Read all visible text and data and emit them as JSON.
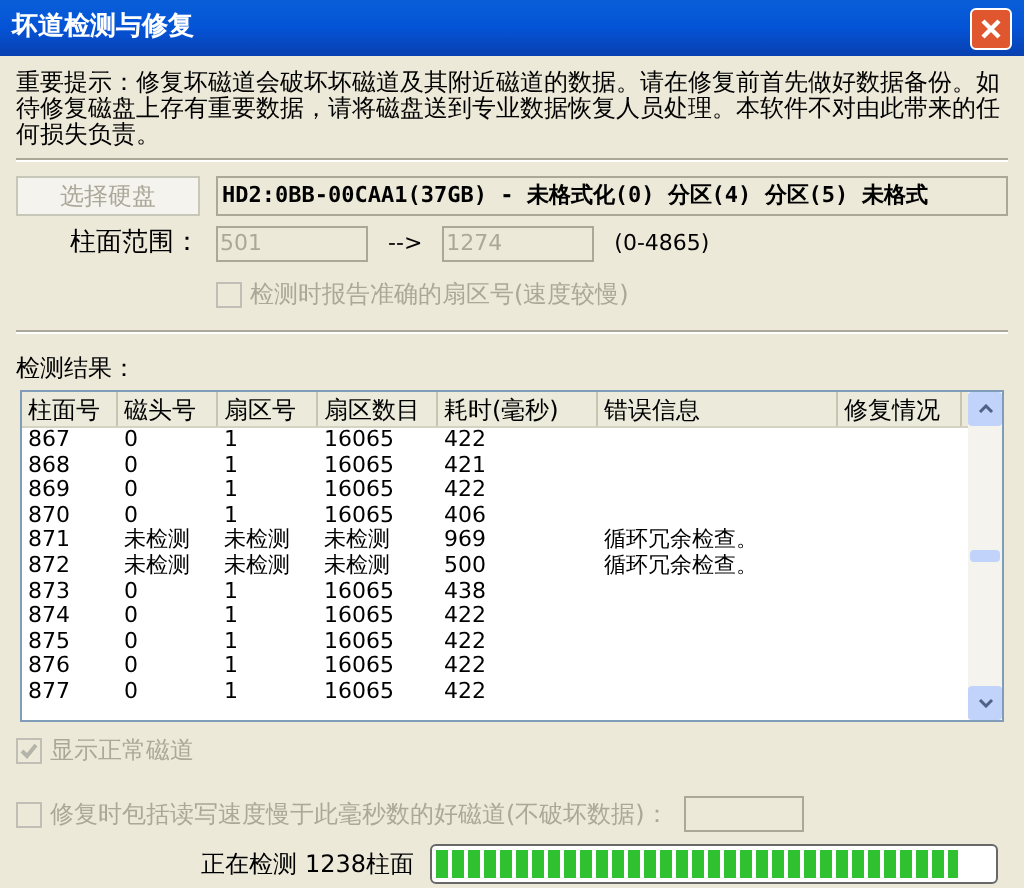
{
  "window": {
    "title": "坏道检测与修复"
  },
  "notice": "重要提示：修复坏磁道会破坏坏磁道及其附近磁道的数据。请在修复前首先做好数据备份。如待修复磁盘上存有重要数据，请将磁盘送到专业数据恢复人员处理。本软件不对由此带来的任何损失负责。",
  "select_disk_button": {
    "label": "选择硬盘",
    "disabled": true
  },
  "disk_info": "HD2:0BB-00CAA1(37GB) - 未格式化(0) 分区(4) 分区(5) 未格式",
  "cylinder_range": {
    "label": "柱面范围：",
    "from": "501",
    "arrow": "-->",
    "to": "1274",
    "range": "(0-4865)"
  },
  "report_sector_checkbox": {
    "label": "检测时报告准确的扇区号(速度较慢)",
    "checked": false,
    "disabled": true
  },
  "results_label": "检测结果：",
  "table": {
    "columns": [
      "柱面号",
      "磁头号",
      "扇区号",
      "扇区数目",
      "耗时(毫秒)",
      "错误信息",
      "修复情况"
    ],
    "rows": [
      [
        "867",
        "0",
        "1",
        "16065",
        "422",
        "",
        ""
      ],
      [
        "868",
        "0",
        "1",
        "16065",
        "421",
        "",
        ""
      ],
      [
        "869",
        "0",
        "1",
        "16065",
        "422",
        "",
        ""
      ],
      [
        "870",
        "0",
        "1",
        "16065",
        "406",
        "",
        ""
      ],
      [
        "871",
        "未检测",
        "未检测",
        "未检测",
        "969",
        "循环冗余检查。",
        ""
      ],
      [
        "872",
        "未检测",
        "未检测",
        "未检测",
        "500",
        "循环冗余检查。",
        ""
      ],
      [
        "873",
        "0",
        "1",
        "16065",
        "438",
        "",
        ""
      ],
      [
        "874",
        "0",
        "1",
        "16065",
        "422",
        "",
        ""
      ],
      [
        "875",
        "0",
        "1",
        "16065",
        "422",
        "",
        ""
      ],
      [
        "876",
        "0",
        "1",
        "16065",
        "422",
        "",
        ""
      ],
      [
        "877",
        "0",
        "1",
        "16065",
        "422",
        "",
        ""
      ]
    ]
  },
  "show_normal_checkbox": {
    "label": "显示正常磁道",
    "checked": true,
    "disabled": true
  },
  "include_slow_checkbox": {
    "label": "修复时包括读写速度慢于此毫秒数的好磁道(不破坏数据)：",
    "checked": false,
    "disabled": true
  },
  "progress": {
    "label": "正在检测 1238柱面",
    "level": 0.94
  }
}
